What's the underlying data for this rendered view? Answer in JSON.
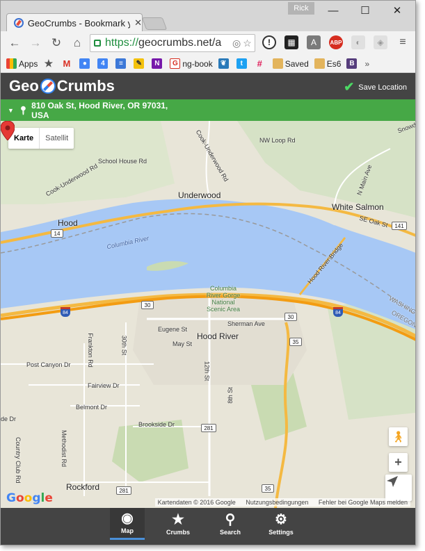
{
  "window": {
    "user": "Rick",
    "minimize": "—",
    "maximize": "☐",
    "close": "✕"
  },
  "tab": {
    "title": "GeoCrumbs - Bookmark y",
    "close": "✕"
  },
  "toolbar": {
    "url_scheme": "https://",
    "url_host": "geocrumbs.net/",
    "url_rest": "a"
  },
  "bookmarks": [
    {
      "label": "Apps",
      "icon": "apps-icon"
    },
    {
      "label": "",
      "icon": "star-icon"
    },
    {
      "label": "",
      "icon": "gmail-icon"
    },
    {
      "label": "",
      "icon": "contacts-icon"
    },
    {
      "label": "",
      "icon": "calendar-icon"
    },
    {
      "label": "",
      "icon": "sheets-icon"
    },
    {
      "label": "",
      "icon": "notes-icon"
    },
    {
      "label": "",
      "icon": "onenote-icon"
    },
    {
      "label": "ng-book",
      "icon": "ngbook-icon"
    },
    {
      "label": "",
      "icon": "leaf-icon"
    },
    {
      "label": "",
      "icon": "twitter-icon"
    },
    {
      "label": "",
      "icon": "slack-icon"
    },
    {
      "label": "Saved",
      "icon": "folder-icon"
    },
    {
      "label": "Es6",
      "icon": "es6-icon"
    },
    {
      "label": "",
      "icon": "bootstrap-icon"
    }
  ],
  "app": {
    "logo_left": "Geo",
    "logo_right": "Crumbs",
    "save_location": "Save Location",
    "address": "810 Oak St, Hood River, OR 97031, USA"
  },
  "map": {
    "type_map": "Karte",
    "type_satellite": "Satellit",
    "labels": {
      "underwood": "Underwood",
      "white_salmon": "White Salmon",
      "hood": "Hood",
      "hood_river": "Hood River",
      "columbia_river": "Columbia River",
      "gorge": "Columbia River Gorge National Scenic Area",
      "school_house": "School House Rd",
      "cook_underwood_1": "Cook-Underwood Rd",
      "cook_underwood_2": "Cook-Underwood Rd",
      "nw_loop": "NW Loop Rd",
      "n_main": "N Main Ave",
      "se_oak": "SE Oak St",
      "hood_river_bridge": "Hood River Bridge",
      "sherman": "Sherman Ave",
      "eugene": "Eugene St",
      "may": "May St",
      "30th": "30th St",
      "12th": "12th St",
      "8th": "8th St",
      "frankton": "Frankton Rd",
      "post_canyon": "Post Canyon Dr",
      "fairview": "Fairview Dr",
      "belmont": "Belmont Dr",
      "brookside": "Brookside Dr",
      "country_club": "Country Club Rd",
      "methodist": "Methodist Rd",
      "rockford": "Rockford",
      "washington": "WASHINGTON",
      "oregon": "OREGON",
      "snowden": "Snowd",
      "side_dr": "de Dr"
    },
    "shields": {
      "s14": "14",
      "s141": "141",
      "s30a": "30",
      "s30b": "30",
      "s35a": "35",
      "s35b": "35",
      "s281a": "281",
      "s281b": "281",
      "i84a": "84",
      "i84b": "84"
    },
    "zoom_in": "+",
    "google": "Google",
    "map_data": "Kartendaten © 2016 Google",
    "terms": "Nutzungsbedingungen",
    "report": "Fehler bei Google Maps melden"
  },
  "bottom_nav": [
    {
      "label": "Map",
      "icon": "compass-icon",
      "active": true
    },
    {
      "label": "Crumbs",
      "icon": "star-icon",
      "active": false
    },
    {
      "label": "Search",
      "icon": "search-icon",
      "active": false
    },
    {
      "label": "Settings",
      "icon": "gear-icon",
      "active": false
    }
  ]
}
